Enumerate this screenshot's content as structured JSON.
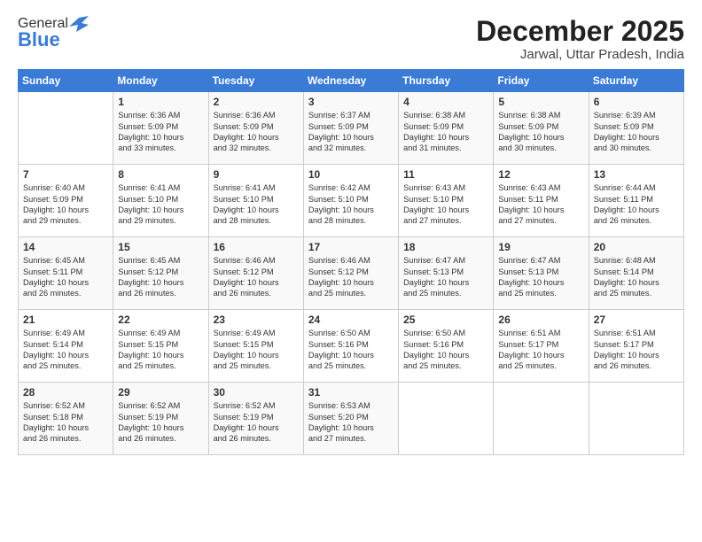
{
  "logo": {
    "general": "General",
    "blue": "Blue"
  },
  "header": {
    "month": "December 2025",
    "location": "Jarwal, Uttar Pradesh, India"
  },
  "weekdays": [
    "Sunday",
    "Monday",
    "Tuesday",
    "Wednesday",
    "Thursday",
    "Friday",
    "Saturday"
  ],
  "weeks": [
    [
      {
        "day": "",
        "content": ""
      },
      {
        "day": "1",
        "content": "Sunrise: 6:36 AM\nSunset: 5:09 PM\nDaylight: 10 hours\nand 33 minutes."
      },
      {
        "day": "2",
        "content": "Sunrise: 6:36 AM\nSunset: 5:09 PM\nDaylight: 10 hours\nand 32 minutes."
      },
      {
        "day": "3",
        "content": "Sunrise: 6:37 AM\nSunset: 5:09 PM\nDaylight: 10 hours\nand 32 minutes."
      },
      {
        "day": "4",
        "content": "Sunrise: 6:38 AM\nSunset: 5:09 PM\nDaylight: 10 hours\nand 31 minutes."
      },
      {
        "day": "5",
        "content": "Sunrise: 6:38 AM\nSunset: 5:09 PM\nDaylight: 10 hours\nand 30 minutes."
      },
      {
        "day": "6",
        "content": "Sunrise: 6:39 AM\nSunset: 5:09 PM\nDaylight: 10 hours\nand 30 minutes."
      }
    ],
    [
      {
        "day": "7",
        "content": "Sunrise: 6:40 AM\nSunset: 5:09 PM\nDaylight: 10 hours\nand 29 minutes."
      },
      {
        "day": "8",
        "content": "Sunrise: 6:41 AM\nSunset: 5:10 PM\nDaylight: 10 hours\nand 29 minutes."
      },
      {
        "day": "9",
        "content": "Sunrise: 6:41 AM\nSunset: 5:10 PM\nDaylight: 10 hours\nand 28 minutes."
      },
      {
        "day": "10",
        "content": "Sunrise: 6:42 AM\nSunset: 5:10 PM\nDaylight: 10 hours\nand 28 minutes."
      },
      {
        "day": "11",
        "content": "Sunrise: 6:43 AM\nSunset: 5:10 PM\nDaylight: 10 hours\nand 27 minutes."
      },
      {
        "day": "12",
        "content": "Sunrise: 6:43 AM\nSunset: 5:11 PM\nDaylight: 10 hours\nand 27 minutes."
      },
      {
        "day": "13",
        "content": "Sunrise: 6:44 AM\nSunset: 5:11 PM\nDaylight: 10 hours\nand 26 minutes."
      }
    ],
    [
      {
        "day": "14",
        "content": "Sunrise: 6:45 AM\nSunset: 5:11 PM\nDaylight: 10 hours\nand 26 minutes."
      },
      {
        "day": "15",
        "content": "Sunrise: 6:45 AM\nSunset: 5:12 PM\nDaylight: 10 hours\nand 26 minutes."
      },
      {
        "day": "16",
        "content": "Sunrise: 6:46 AM\nSunset: 5:12 PM\nDaylight: 10 hours\nand 26 minutes."
      },
      {
        "day": "17",
        "content": "Sunrise: 6:46 AM\nSunset: 5:12 PM\nDaylight: 10 hours\nand 25 minutes."
      },
      {
        "day": "18",
        "content": "Sunrise: 6:47 AM\nSunset: 5:13 PM\nDaylight: 10 hours\nand 25 minutes."
      },
      {
        "day": "19",
        "content": "Sunrise: 6:47 AM\nSunset: 5:13 PM\nDaylight: 10 hours\nand 25 minutes."
      },
      {
        "day": "20",
        "content": "Sunrise: 6:48 AM\nSunset: 5:14 PM\nDaylight: 10 hours\nand 25 minutes."
      }
    ],
    [
      {
        "day": "21",
        "content": "Sunrise: 6:49 AM\nSunset: 5:14 PM\nDaylight: 10 hours\nand 25 minutes."
      },
      {
        "day": "22",
        "content": "Sunrise: 6:49 AM\nSunset: 5:15 PM\nDaylight: 10 hours\nand 25 minutes."
      },
      {
        "day": "23",
        "content": "Sunrise: 6:49 AM\nSunset: 5:15 PM\nDaylight: 10 hours\nand 25 minutes."
      },
      {
        "day": "24",
        "content": "Sunrise: 6:50 AM\nSunset: 5:16 PM\nDaylight: 10 hours\nand 25 minutes."
      },
      {
        "day": "25",
        "content": "Sunrise: 6:50 AM\nSunset: 5:16 PM\nDaylight: 10 hours\nand 25 minutes."
      },
      {
        "day": "26",
        "content": "Sunrise: 6:51 AM\nSunset: 5:17 PM\nDaylight: 10 hours\nand 25 minutes."
      },
      {
        "day": "27",
        "content": "Sunrise: 6:51 AM\nSunset: 5:17 PM\nDaylight: 10 hours\nand 26 minutes."
      }
    ],
    [
      {
        "day": "28",
        "content": "Sunrise: 6:52 AM\nSunset: 5:18 PM\nDaylight: 10 hours\nand 26 minutes."
      },
      {
        "day": "29",
        "content": "Sunrise: 6:52 AM\nSunset: 5:19 PM\nDaylight: 10 hours\nand 26 minutes."
      },
      {
        "day": "30",
        "content": "Sunrise: 6:52 AM\nSunset: 5:19 PM\nDaylight: 10 hours\nand 26 minutes."
      },
      {
        "day": "31",
        "content": "Sunrise: 6:53 AM\nSunset: 5:20 PM\nDaylight: 10 hours\nand 27 minutes."
      },
      {
        "day": "",
        "content": ""
      },
      {
        "day": "",
        "content": ""
      },
      {
        "day": "",
        "content": ""
      }
    ]
  ]
}
